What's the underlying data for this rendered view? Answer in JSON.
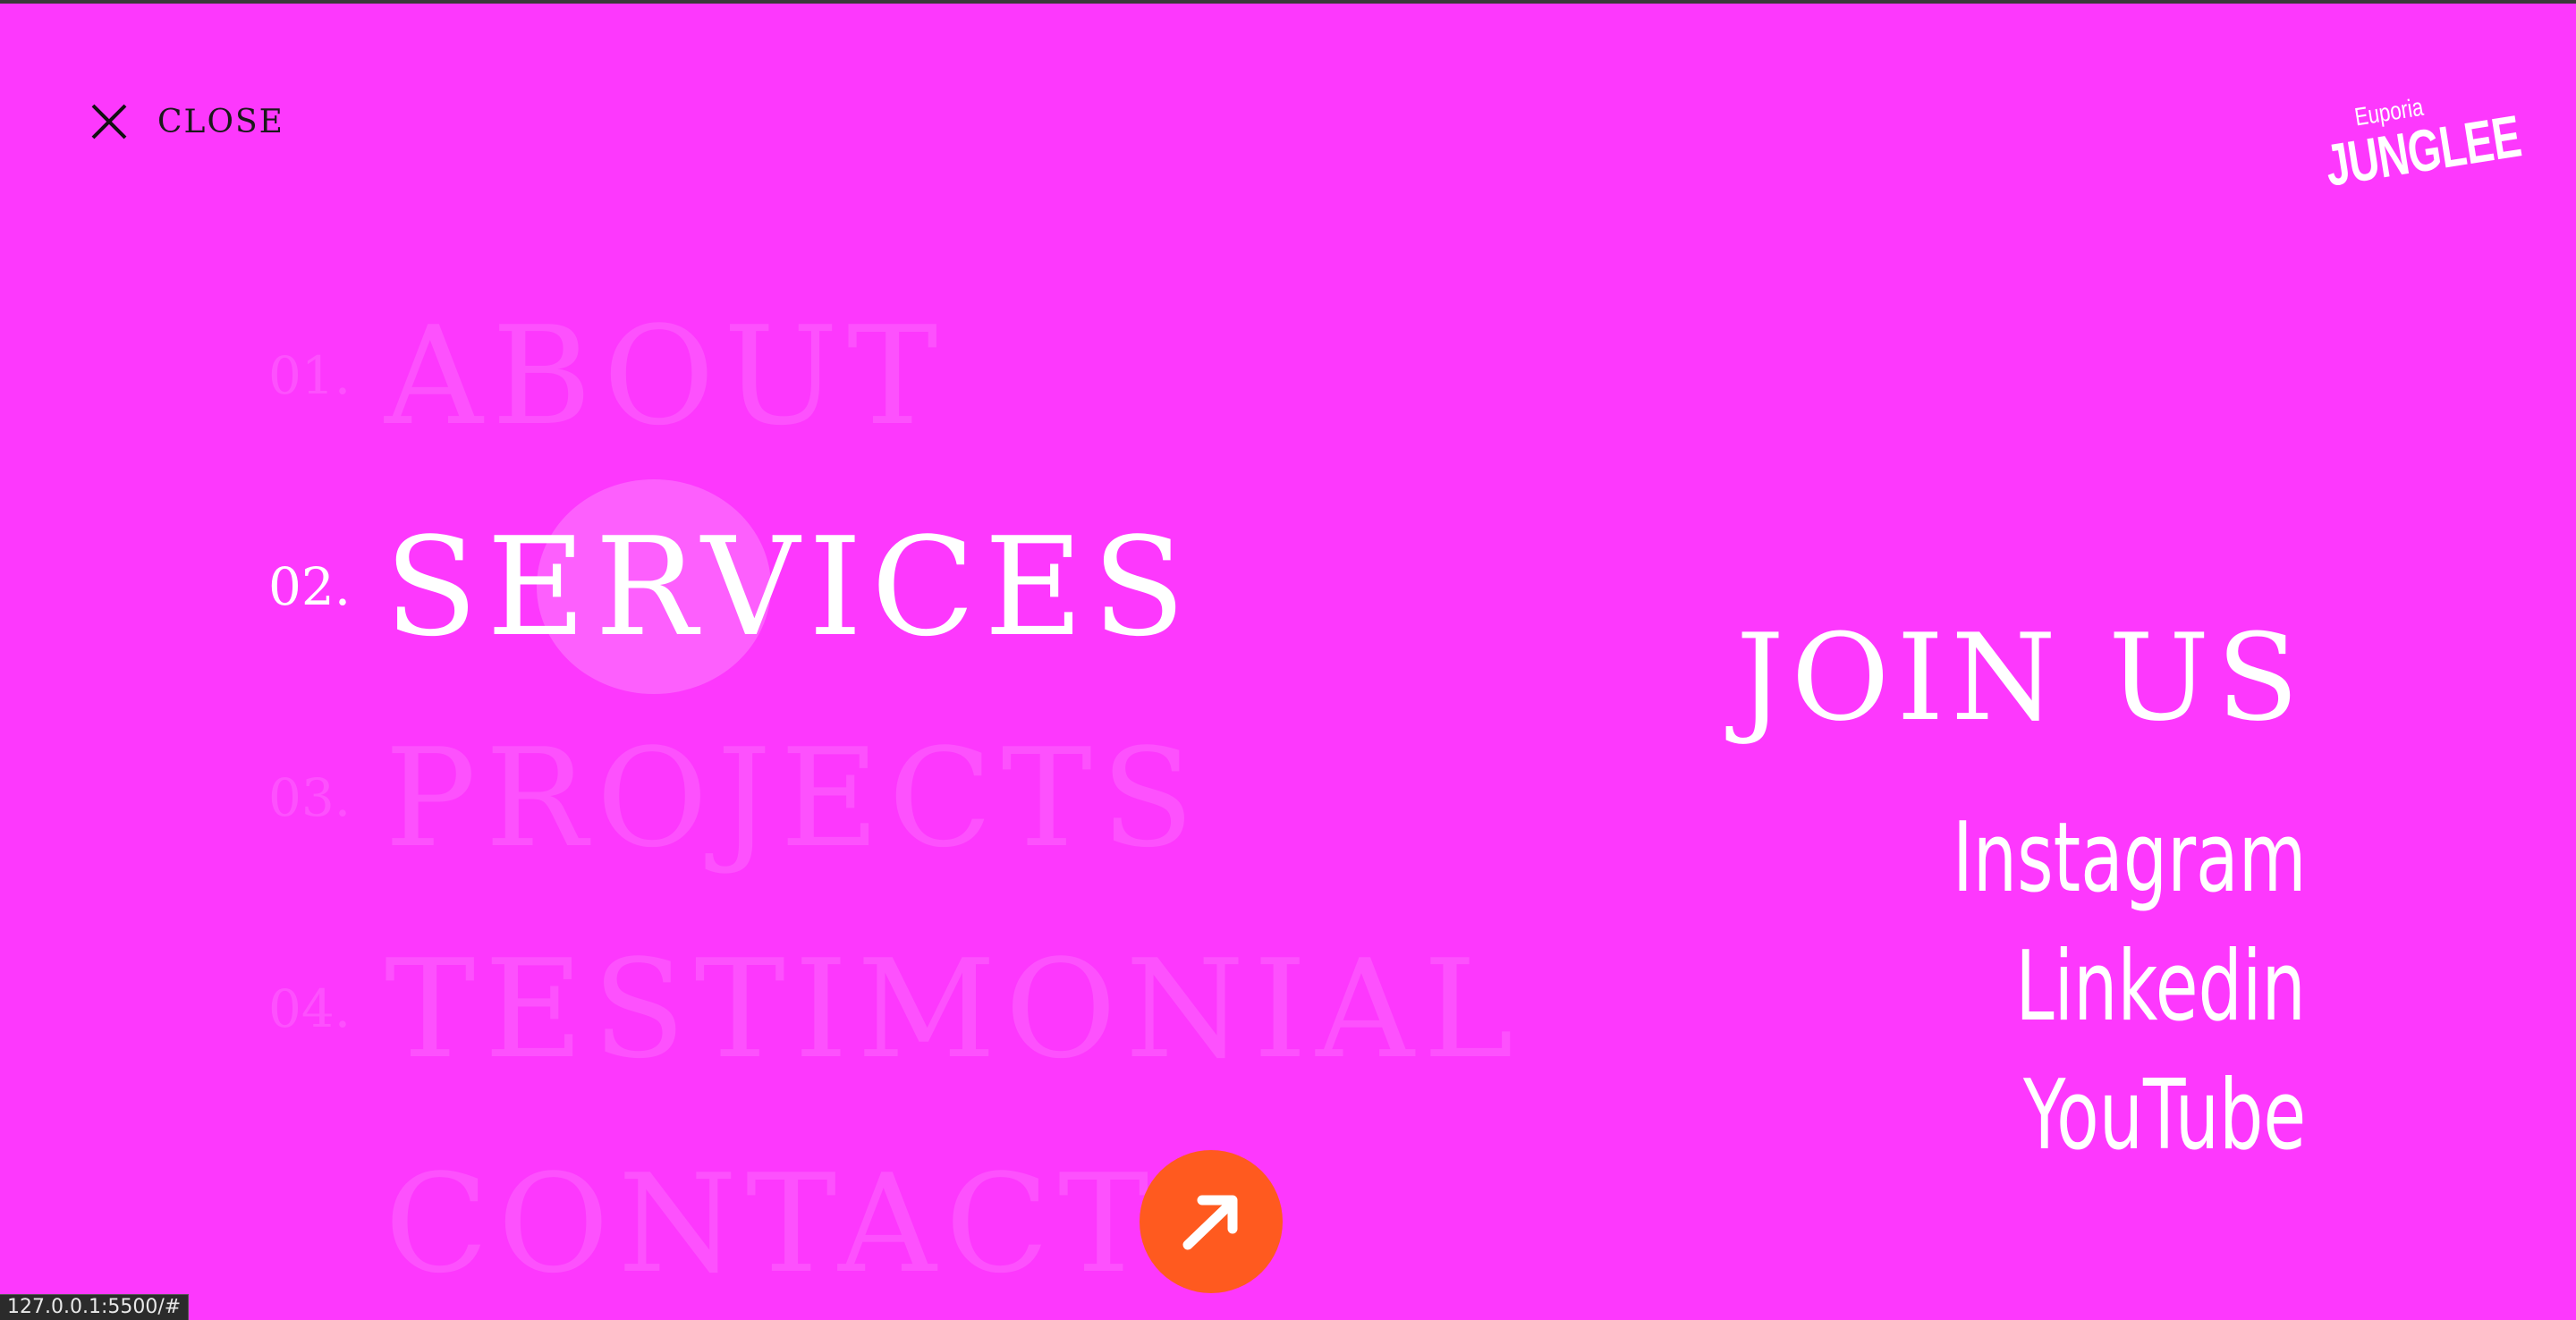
{
  "close": {
    "label": "CLOSE"
  },
  "logo": {
    "small": "Euporia",
    "big": "JUNGLEE"
  },
  "nav": {
    "items": [
      {
        "num": "01.",
        "label": "ABOUT"
      },
      {
        "num": "02.",
        "label": "SERVICES",
        "active": true
      },
      {
        "num": "03.",
        "label": "PROJECTS"
      },
      {
        "num": "04.",
        "label": "TESTIMONIAL"
      },
      {
        "num": "",
        "label": "CONTACT"
      }
    ]
  },
  "join": {
    "title": "JOIN US",
    "links": [
      "Instagram",
      "Linkedin",
      "YouTube"
    ]
  },
  "status": {
    "url": "127.0.0.1:5500/#"
  },
  "colors": {
    "background": "#fd38fd",
    "accent": "#ff5a1f",
    "text": "#ffffff"
  },
  "icons": [
    "close-icon",
    "arrow-up-right-icon"
  ]
}
